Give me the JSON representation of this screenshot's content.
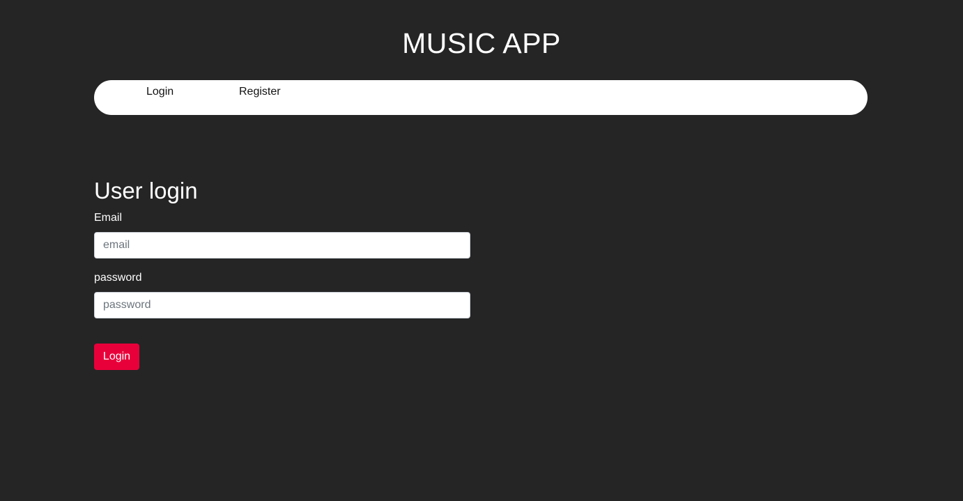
{
  "header": {
    "title": "MUSIC APP"
  },
  "nav": {
    "items": [
      {
        "label": "Login"
      },
      {
        "label": "Register"
      }
    ]
  },
  "login_form": {
    "title": "User login",
    "email": {
      "label": "Email",
      "placeholder": "email",
      "value": ""
    },
    "password": {
      "label": "password",
      "placeholder": "password",
      "value": ""
    },
    "submit_label": "Login"
  },
  "colors": {
    "background": "#252525",
    "navbar": "#ffffff",
    "accent": "#e8003a",
    "text": "#ffffff"
  }
}
